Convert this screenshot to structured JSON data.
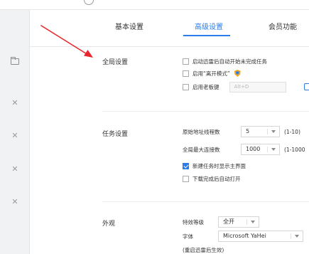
{
  "tabs": [
    {
      "label": "基本设置",
      "active": false
    },
    {
      "label": "高级设置",
      "active": true
    },
    {
      "label": "会员功能",
      "active": false
    }
  ],
  "sections": {
    "global": {
      "title": "全局设置",
      "options": [
        {
          "label": "启动迅雷后自动开始未完成任务",
          "checked": false
        },
        {
          "label": "启用“离开模式”",
          "checked": false,
          "icon": "shield-icon"
        },
        {
          "label": "启用老板键",
          "checked": false
        }
      ],
      "boss_key_value": "Alt+D"
    },
    "task": {
      "title": "任务设置",
      "thread_label": "原始地址线程数",
      "thread_value": "5",
      "thread_range": "(1-10)",
      "conn_label": "全局最大连接数",
      "conn_value": "1000",
      "conn_range": "(1-1000",
      "options": [
        {
          "label": "新建任务时显示主界面",
          "checked": true
        },
        {
          "label": "下载完成后自动打开",
          "checked": false
        }
      ]
    },
    "appearance": {
      "title": "外观",
      "effect_label": "特效等级",
      "effect_value": "全开",
      "font_label": "字体",
      "font_value": "Microsoft YaHei",
      "restart_note": "(重启迅雷后生效)"
    }
  },
  "colors": {
    "accent": "#2b7de9",
    "annotation": "#e8262b",
    "sidebar": "#f1f2f4"
  },
  "sidebar_icons": [
    "folder-icon",
    "close-icon",
    "close-icon",
    "close-icon",
    "close-icon"
  ]
}
